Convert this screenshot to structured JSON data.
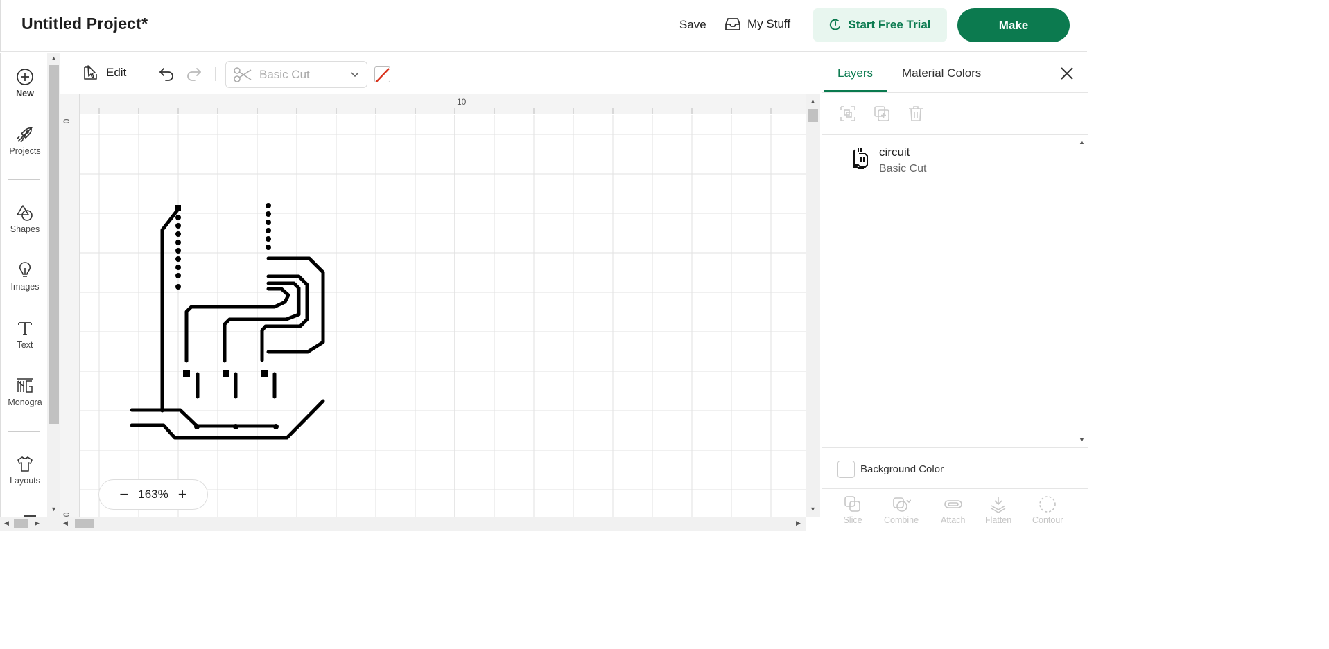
{
  "header": {
    "title": "Untitled Project*",
    "save_label": "Save",
    "mystuff_label": "My Stuff",
    "trial_label": "Start Free Trial",
    "make_label": "Make"
  },
  "sidebar": {
    "items": [
      {
        "label": "New",
        "icon": "plus-circle-icon"
      },
      {
        "label": "Projects",
        "icon": "rocket-icon"
      },
      {
        "label": "Shapes",
        "icon": "shapes-icon"
      },
      {
        "label": "Images",
        "icon": "lightbulb-icon"
      },
      {
        "label": "Text",
        "icon": "text-icon"
      },
      {
        "label": "Monogra",
        "icon": "monogram-icon"
      },
      {
        "label": "Layouts",
        "icon": "shirt-icon"
      }
    ]
  },
  "toolbar": {
    "edit_label": "Edit",
    "operation": "Basic Cut"
  },
  "canvas": {
    "ruler_top_label": "10",
    "ruler_left_label": "0",
    "ruler_left_label_bottom": "0",
    "zoom": "163%",
    "zoom_minus": "−",
    "zoom_plus": "+"
  },
  "panel": {
    "tabs": [
      "Layers",
      "Material Colors"
    ],
    "layer": {
      "name": "circuit",
      "operation": "Basic Cut"
    },
    "background_label": "Background Color",
    "bottom_tools": [
      "Slice",
      "Combine",
      "Attach",
      "Flatten",
      "Contour"
    ]
  },
  "colors": {
    "accent": "#0c7a4f",
    "accent_light": "#e8f6ef"
  }
}
